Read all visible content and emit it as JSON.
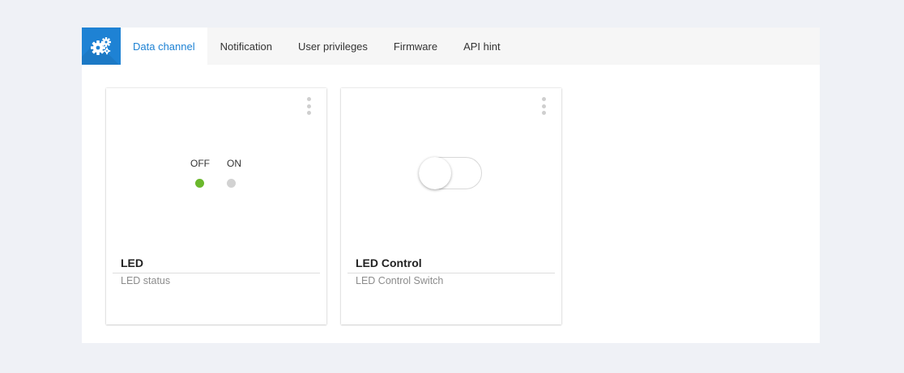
{
  "tabs": [
    {
      "label": "Data channel",
      "active": true
    },
    {
      "label": "Notification",
      "active": false
    },
    {
      "label": "User privileges",
      "active": false
    },
    {
      "label": "Firmware",
      "active": false
    },
    {
      "label": "API hint",
      "active": false
    }
  ],
  "settings_icon": "gears-icon",
  "colors": {
    "accent": "#1e82d4",
    "led_on": "#6bb82c",
    "led_off": "#d2d2d2"
  },
  "cards": [
    {
      "title": "LED",
      "subtitle": "LED status",
      "widget": "led-indicator",
      "off_label": "OFF",
      "on_label": "ON",
      "state": "off"
    },
    {
      "title": "LED Control",
      "subtitle": "LED Control Switch",
      "widget": "toggle-switch",
      "state": "off"
    }
  ]
}
